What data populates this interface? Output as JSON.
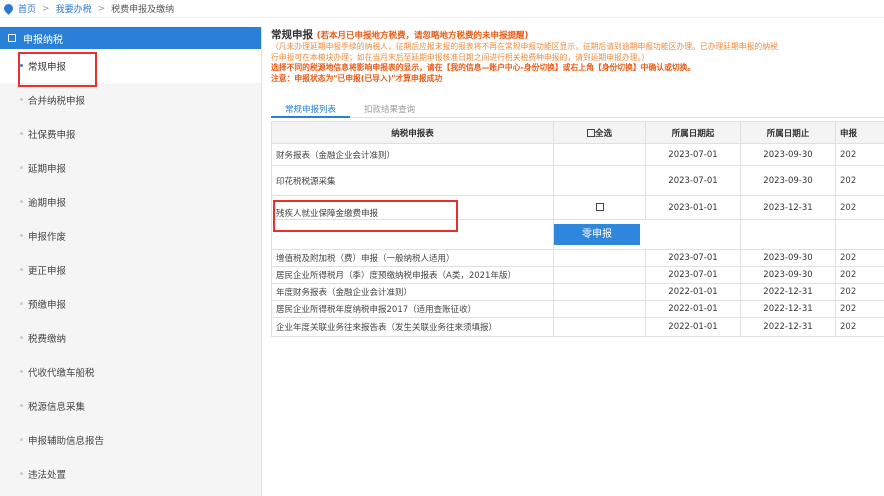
{
  "breadcrumb": {
    "home": "首页",
    "level1": "我要办税",
    "current": "税费申报及缴纳"
  },
  "sidebar": {
    "header": "申报纳税",
    "items": [
      {
        "label": "常规申报",
        "active": true
      },
      {
        "label": "合并纳税申报"
      },
      {
        "label": "社保费申报"
      },
      {
        "label": "延期申报"
      },
      {
        "label": "逾期申报"
      },
      {
        "label": "申报作废"
      },
      {
        "label": "更正申报"
      },
      {
        "label": "预缴申报"
      },
      {
        "label": "税费缴纳"
      },
      {
        "label": "代收代缴车船税"
      },
      {
        "label": "税源信息采集"
      },
      {
        "label": "申报辅助信息报告"
      },
      {
        "label": "违法处置"
      }
    ]
  },
  "main": {
    "title": "常规申报",
    "title_warning": "(若本月已申报地方税费，请忽略地方税费的未申报提醒)",
    "note1": "（凡未办理延期申报手续的纳税人，征期后应报未报的报表将不再在常规申报功能区显示，征期后请到逾期申报功能区办理。已办理延期申报的纳税",
    "note2": "行申报可在本模块办理；如在当月末后至延期申报核准日期之间进行相关税费种申报的，请到延期申报办理。）",
    "note3": "选择不同的税源地信息将影响申报表的显示，请在【我的信息—账户中心-身份切换】或右上角【身份切换】中确认或切换。",
    "note4": "注意：申报状态为\"已申报(已导入)\"才算申报成功",
    "tabs": [
      "常规申报列表",
      "扣款结果查询"
    ],
    "table": {
      "headers": [
        "纳税申报表",
        "全选",
        "所属日期起",
        "所属日期止",
        "申报"
      ],
      "rows": [
        {
          "name": "财务报表（金融企业会计准则）",
          "start": "2023-07-01",
          "end": "2023-09-30",
          "due": "202"
        },
        {
          "name": "印花税税源采集",
          "start": "2023-07-01",
          "end": "2023-09-30",
          "due": "202"
        },
        {
          "name": "残疾人就业保障金缴费申报",
          "start": "2023-01-01",
          "end": "2023-12-31",
          "due": "202"
        },
        {
          "name": "增值税及附加税（费）申报（一般纳税人适用）",
          "start": "2023-07-01",
          "end": "2023-09-30",
          "due": "202"
        },
        {
          "name": "居民企业所得税月（季）度预缴纳税申报表（A类，2021年版）",
          "start": "2023-07-01",
          "end": "2023-09-30",
          "due": "202"
        },
        {
          "name": "年度财务报表（金融企业会计准则）",
          "start": "2022-01-01",
          "end": "2022-12-31",
          "due": "202"
        },
        {
          "name": "居民企业所得税年度纳税申报2017（适用查账征收）",
          "start": "2022-01-01",
          "end": "2022-12-31",
          "due": "202"
        },
        {
          "name": "企业年度关联业务往来报告表（发生关联业务往来须填报）",
          "start": "2022-01-01",
          "end": "2022-12-31",
          "due": "202"
        }
      ],
      "zero_button": "零申报"
    }
  },
  "colors": {
    "accent": "#2a80d6",
    "highlight": "#e8312a",
    "warning": "#e85b17"
  }
}
